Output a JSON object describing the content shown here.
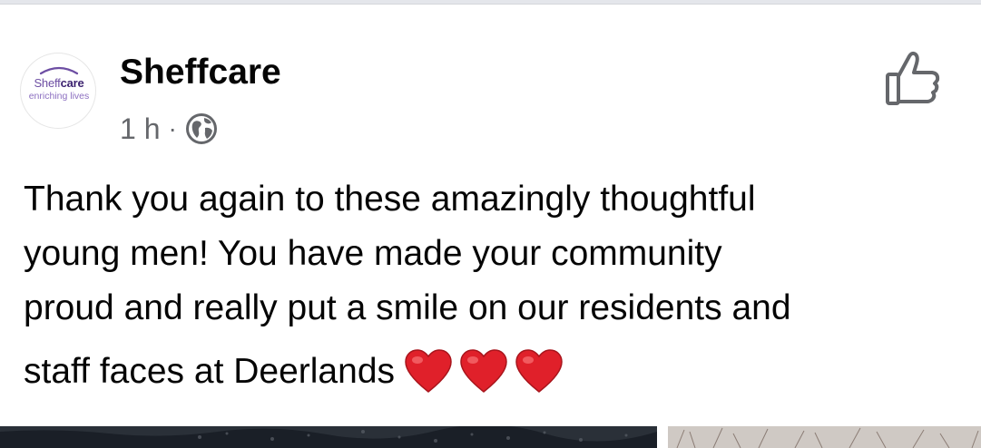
{
  "post": {
    "author": "Sheffcare",
    "avatar": {
      "logo_word_part1": "Sheff",
      "logo_word_part2": "care",
      "logo_tagline": "enriching lives"
    },
    "timestamp": "1 h",
    "separator": "·",
    "audience_icon": "globe-icon",
    "like_icon": "thumbs-up-icon",
    "text_lines": [
      "Thank you again to these amazingly thoughtful",
      "young men! You have made your community",
      "proud and really put a smile on our residents and",
      "staff faces at Deerlands"
    ],
    "emojis": [
      "heart-icon",
      "heart-icon",
      "heart-icon"
    ]
  },
  "colors": {
    "text_primary": "#050505",
    "text_secondary": "#65676b",
    "brand_purple": "#5a3e8c",
    "heart_red": "#e0202a",
    "icon_gray": "#65676b"
  }
}
